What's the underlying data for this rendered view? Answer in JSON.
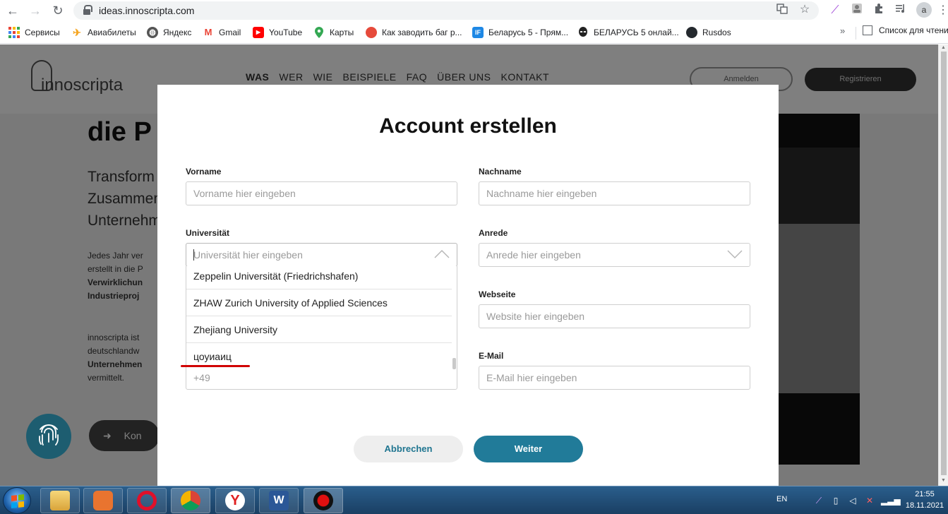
{
  "browser": {
    "url": "ideas.innoscripta.com",
    "back_glyph": "←",
    "forward_glyph": "→",
    "reload_glyph": "↻",
    "bookmarks": [
      {
        "label": "Сервисы",
        "icon": "apps-grid-icon"
      },
      {
        "label": "Авиабилеты",
        "icon": "plane-icon",
        "color": "#f5a623"
      },
      {
        "label": "Яндекс",
        "icon": "globe-icon",
        "color": "#555555"
      },
      {
        "label": "Gmail",
        "icon": "gmail-icon",
        "color": "#ea4335"
      },
      {
        "label": "YouTube",
        "icon": "youtube-icon",
        "color": "#ff0000"
      },
      {
        "label": "Карты",
        "icon": "maps-pin-icon",
        "color": "#34a853"
      },
      {
        "label": "Как заводить баг р...",
        "icon": "bug-icon",
        "color": "#e64a3b"
      },
      {
        "label": "Беларусь 5 - Прям...",
        "icon": "belarus5-icon",
        "color": "#1e88e5"
      },
      {
        "label": "БЕЛАРУСЬ 5 онлай...",
        "icon": "alien-icon",
        "color": "#222222"
      },
      {
        "label": "Rusdos",
        "icon": "github-icon",
        "color": "#24292e"
      }
    ],
    "more_glyph": "»",
    "reading_list_label": "Список для чтения",
    "avatar_letter": "a"
  },
  "site": {
    "brand": "innoscripta",
    "nav": [
      "WAS",
      "WER",
      "WIE",
      "BEISPIELE",
      "FAQ",
      "ÜBER UNS",
      "KONTAKT"
    ],
    "login_label": "Anmelden",
    "register_label": "Registrieren",
    "headline": "die P",
    "lead_lines": [
      "Transform",
      "Zusammen",
      "Unternehm"
    ],
    "para1_lines": [
      "Jedes Jahr ver",
      "erstellt in die P",
      "Verwirklichun",
      "Industrieproj"
    ],
    "para2_lines": [
      "innoscripta ist",
      "deutschlandw",
      "Unternehmen",
      "vermittelt."
    ],
    "cta_label": "Kon",
    "cta_glyph": "➜"
  },
  "modal": {
    "title": "Account erstellen",
    "vorname": {
      "label": "Vorname",
      "placeholder": "Vorname hier eingeben"
    },
    "nachname": {
      "label": "Nachname",
      "placeholder": "Nachname hier eingeben"
    },
    "universitaet": {
      "label": "Universität",
      "placeholder": "Universität hier eingeben"
    },
    "anrede": {
      "label": "Anrede",
      "placeholder": "Anrede hier eingeben"
    },
    "webseite": {
      "label": "Webseite",
      "placeholder": "Website hier eingeben"
    },
    "email": {
      "label": "E-Mail",
      "placeholder": "E-Mail hier eingeben"
    },
    "phone_prefix": "+49",
    "dropdown_items": [
      "Zeppelin Universität (Friedrichshafen)",
      "ZHAW Zurich University of Applied Sciences",
      "Zhejiang University",
      "цоуиаиц"
    ],
    "cancel_label": "Abbrechen",
    "next_label": "Weiter"
  },
  "taskbar": {
    "language": "EN",
    "time": "21:55",
    "date": "18.11.2021"
  },
  "colors": {
    "accent": "#217b99",
    "cancel_text": "#1f7590",
    "highlight_red": "#d00000"
  }
}
